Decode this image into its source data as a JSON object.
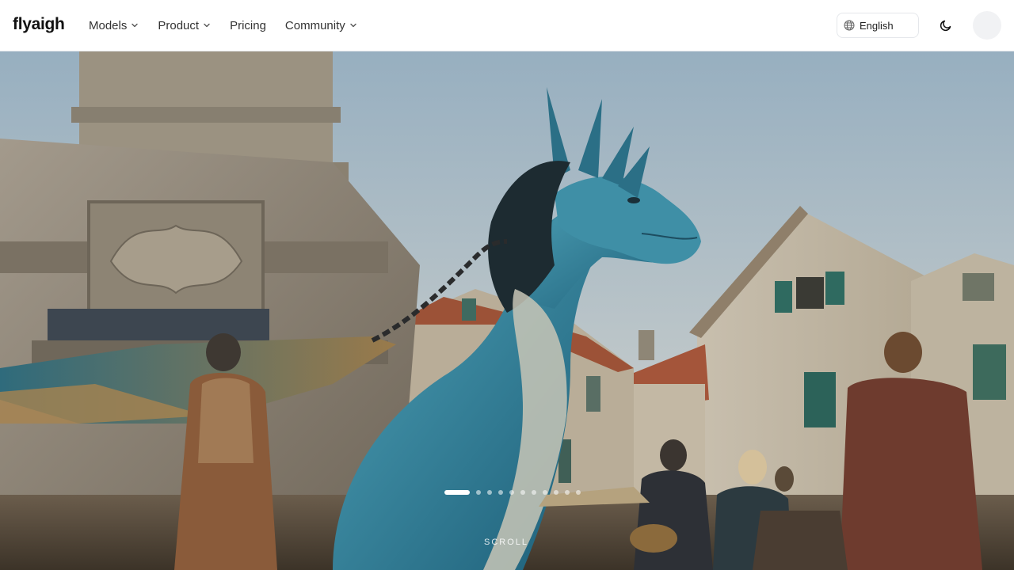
{
  "brand": {
    "name": "flyaigh"
  },
  "nav": {
    "items": [
      {
        "label": "Models",
        "has_dropdown": true
      },
      {
        "label": "Product",
        "has_dropdown": true
      },
      {
        "label": "Pricing",
        "has_dropdown": false
      },
      {
        "label": "Community",
        "has_dropdown": true
      }
    ]
  },
  "header": {
    "language": "English",
    "language_icon": "globe-icon",
    "theme_icon": "moon-icon"
  },
  "hero": {
    "image_subject": "blue-dragon-in-town-square",
    "carousel": {
      "total": 12,
      "active_index": 0
    },
    "scroll_label": "SCROLL"
  },
  "colors": {
    "text": "#333333",
    "border": "#e5e7eb",
    "dot_active": "#ffffff"
  }
}
